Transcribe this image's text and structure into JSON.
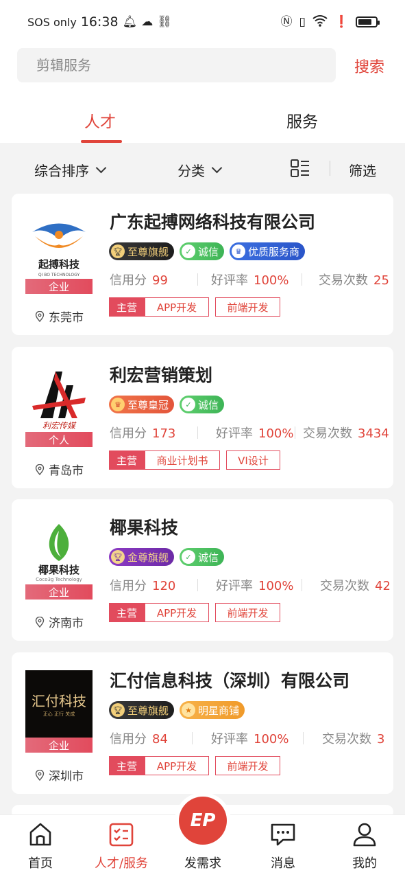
{
  "status_bar": {
    "carrier": "SOS only",
    "time": "16:38",
    "battery_level": 0.8
  },
  "search": {
    "placeholder": "剪辑服务",
    "button_label": "搜索"
  },
  "tabs": [
    {
      "label": "人才",
      "active": true
    },
    {
      "label": "服务",
      "active": false
    }
  ],
  "filters": {
    "sort_label": "综合排序",
    "category_label": "分类",
    "filter_label": "筛选"
  },
  "cards": [
    {
      "name": "广东起搏网络科技有限公司",
      "logo_text": "起搏科技",
      "logo_sub": "QI BO TECHNOLOGY",
      "type": "企业",
      "location": "东莞市",
      "badges": [
        "至尊旗舰",
        "诚信",
        "优质服务商"
      ],
      "credit_label": "信用分",
      "credit": "99",
      "rating_label": "好评率",
      "rating": "100%",
      "trades_label": "交易次数",
      "trades": "25",
      "main_label": "主营",
      "tags": [
        "APP开发",
        "前端开发"
      ]
    },
    {
      "name": "利宏营销策划",
      "logo_text": "利宏传媒",
      "logo_sub": "",
      "type": "个人",
      "location": "青岛市",
      "badges": [
        "至尊皇冠",
        "诚信"
      ],
      "credit_label": "信用分",
      "credit": "173",
      "rating_label": "好评率",
      "rating": "100%",
      "trades_label": "交易次数",
      "trades": "3434",
      "main_label": "主营",
      "tags": [
        "商业计划书",
        "VI设计"
      ]
    },
    {
      "name": "椰果科技",
      "logo_text": "椰果科技",
      "logo_sub": "Coco3g Technology",
      "type": "企业",
      "location": "济南市",
      "badges": [
        "金尊旗舰",
        "诚信"
      ],
      "credit_label": "信用分",
      "credit": "120",
      "rating_label": "好评率",
      "rating": "100%",
      "trades_label": "交易次数",
      "trades": "42",
      "main_label": "主营",
      "tags": [
        "APP开发",
        "前端开发"
      ]
    },
    {
      "name": "汇付信息科技（深圳）有限公司",
      "logo_text": "汇付科技",
      "logo_sub": "正心 正行 关成",
      "type": "企业",
      "location": "深圳市",
      "badges": [
        "至尊旗舰",
        "明星商铺"
      ],
      "credit_label": "信用分",
      "credit": "84",
      "rating_label": "好评率",
      "rating": "100%",
      "trades_label": "交易次数",
      "trades": "3",
      "main_label": "主营",
      "tags": [
        "APP开发",
        "前端开发"
      ]
    }
  ],
  "bottom_nav": {
    "home": "首页",
    "talent": "人才/服务",
    "post": "发需求",
    "post_icon_text": "EP",
    "messages": "消息",
    "mine": "我的"
  },
  "colors": {
    "accent": "#e0443a",
    "tag_red": "#e24b5d",
    "background": "#f3f3f3"
  }
}
